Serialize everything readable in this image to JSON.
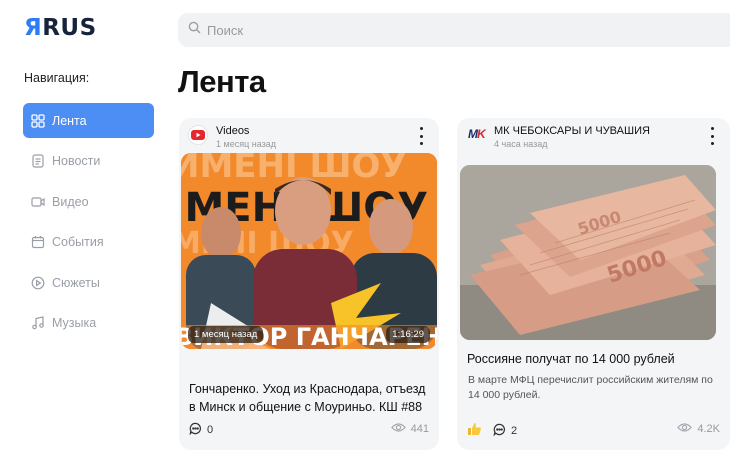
{
  "logo": {
    "part1": "Я",
    "part2": "RUS"
  },
  "search": {
    "placeholder": "Поиск"
  },
  "nav": {
    "label": "Навигация:",
    "items": [
      {
        "label": "Лента",
        "icon": "grid-icon",
        "active": true
      },
      {
        "label": "Новости",
        "icon": "document-icon"
      },
      {
        "label": "Видео",
        "icon": "video-icon"
      },
      {
        "label": "События",
        "icon": "calendar-icon"
      },
      {
        "label": "Сюжеты",
        "icon": "play-circle-icon"
      },
      {
        "label": "Музыка",
        "icon": "music-note-icon"
      }
    ]
  },
  "page": {
    "title": "Лента"
  },
  "cards": [
    {
      "source": "Videos",
      "time": "1 месяц назад",
      "thumb_time": "1 месяц назад",
      "duration": "1:16:29",
      "title": "Гончаренко. Уход из Краснодара, отъезд в Минск и общение с Моуриньо. КШ #88",
      "comments": "0",
      "views": "441"
    },
    {
      "source": "МК ЧЕБОКСАРЫ И ЧУВАШИЯ",
      "time": "4 часа назад",
      "title": "Россияне получат по 14 000 рублей",
      "desc": "В марте МФЦ перечислит российским жителям по 14 000 рублей.",
      "comments": "2",
      "views": "4.2K"
    }
  ],
  "colors": {
    "accent": "#4d8ef5",
    "brand": "#2b7cf6",
    "youtube_red": "#e4262d"
  }
}
